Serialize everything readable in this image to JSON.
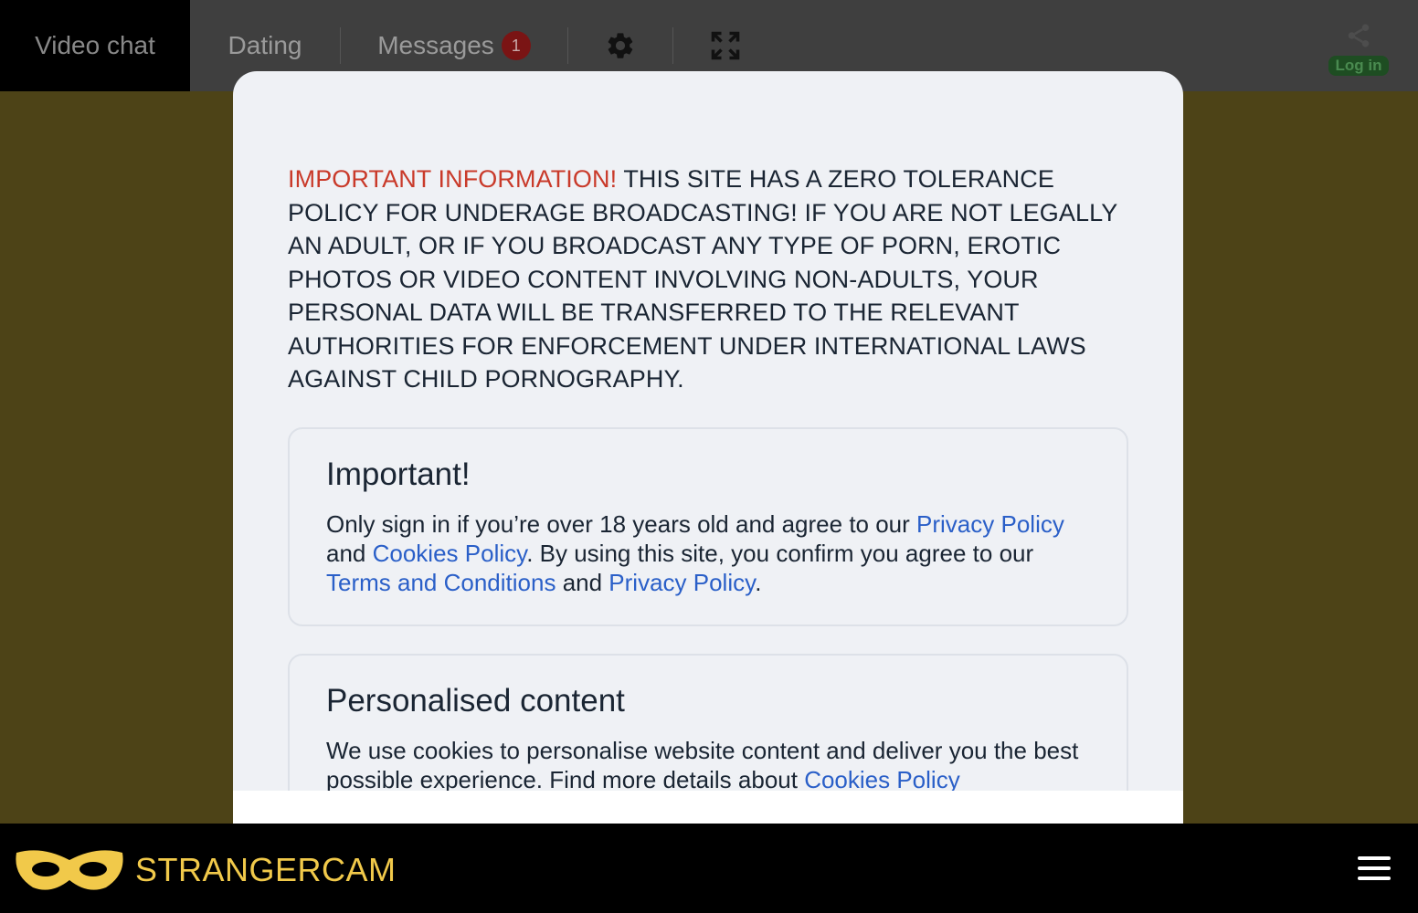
{
  "nav": {
    "video_chat": "Video chat",
    "dating": "Dating",
    "messages": "Messages",
    "messages_badge": "1",
    "settings_icon": "gear-icon",
    "fullscreen_icon": "expand-icon",
    "login": "Log in"
  },
  "modal": {
    "warning_lead": "IMPORTANT INFORMATION!",
    "warning_text": " THIS SITE HAS A ZERO TOLERANCE POLICY FOR UNDERAGE BROADCASTING! IF YOU ARE NOT LEGALLY AN ADULT, OR IF YOU BROADCAST ANY TYPE OF PORN, EROTIC PHOTOS OR VIDEO CONTENT INVOLVING NON-ADULTS, YOUR PERSONAL DATA WILL BE TRANSFERRED TO THE RELEVANT AUTHORITIES FOR ENFORCEMENT UNDER INTERNATIONAL LAWS AGAINST CHILD PORNOGRAPHY.",
    "card1": {
      "title": "Important!",
      "text1": "Only sign in if you’re over 18 years old and agree to our ",
      "link1": "Privacy Policy",
      "text2": " and ",
      "link2": "Cookies Policy",
      "text3": ". By using this site, you confirm you agree to our ",
      "link3": "Terms and Conditions",
      "text4": " and ",
      "link4": "Privacy Policy",
      "text5": "."
    },
    "card2": {
      "title": "Personalised content",
      "text1": "We use cookies to personalise website content and deliver you the best possible experience. Find more details about ",
      "link1": "Cookies Policy"
    }
  },
  "brand": {
    "name": "STRANGERCAM",
    "color": "#f1c94a"
  },
  "menu_icon": "hamburger-menu-icon"
}
